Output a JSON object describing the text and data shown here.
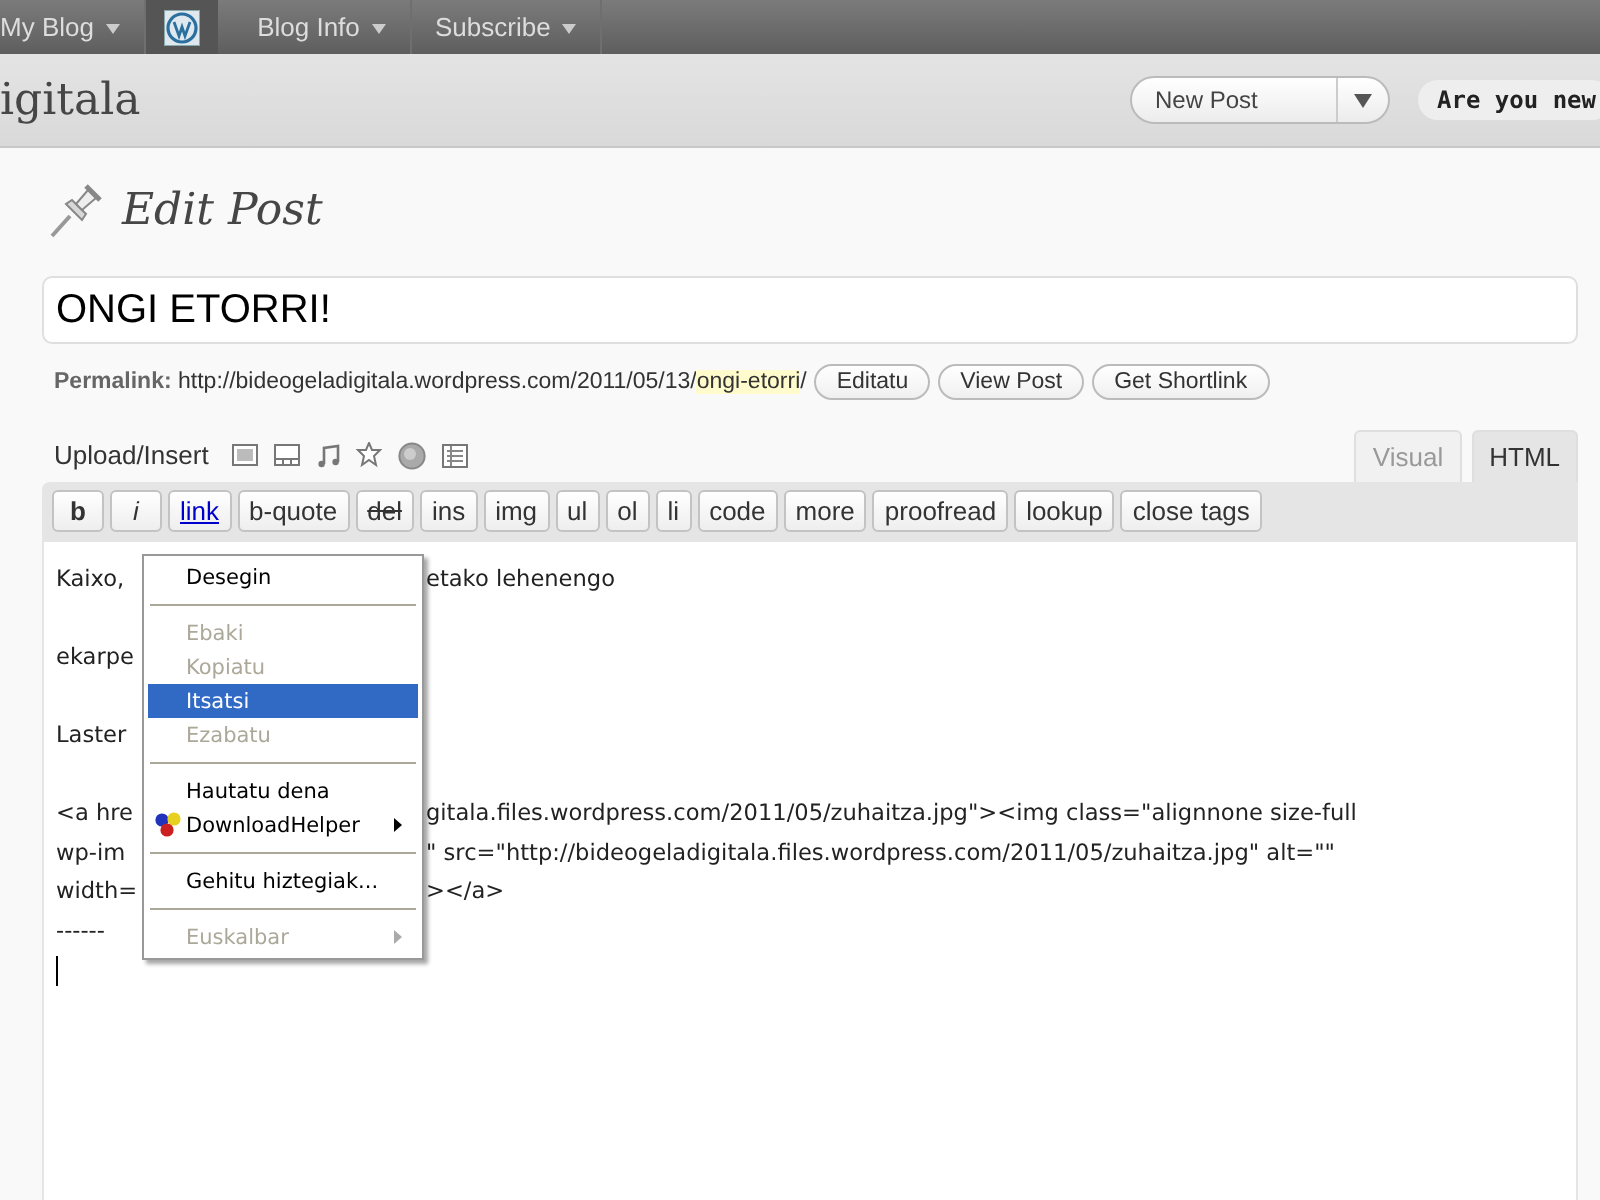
{
  "admin_bar": {
    "items": [
      {
        "label": "My Blog",
        "kind": "menu"
      },
      {
        "kind": "logo"
      },
      {
        "label": "Blog Info",
        "kind": "menu"
      },
      {
        "label": "Subscribe",
        "kind": "menu"
      }
    ]
  },
  "header": {
    "blog_title": "igitala",
    "new_post_button": "New Post",
    "promo": "Are you new"
  },
  "page_title": "Edit Post",
  "post_title": "ONGI ETORRI!",
  "permalink": {
    "label": "Permalink:",
    "url_base": "http://bideogeladigitala.wordpress.com/2011/05/13/",
    "slug": "ongi-etorri",
    "url_end": "/",
    "buttons": [
      "Editatu",
      "View Post",
      "Get Shortlink"
    ]
  },
  "upload_insert": {
    "label": "Upload/Insert",
    "icons": [
      {
        "kind": "image"
      },
      {
        "kind": "video"
      },
      {
        "kind": "audio"
      },
      {
        "kind": "media"
      },
      {
        "kind": "poll"
      },
      {
        "kind": "form"
      }
    ]
  },
  "editor_tabs": [
    {
      "label": "Visual",
      "selected": false
    },
    {
      "label": "HTML",
      "selected": true
    }
  ],
  "quicktags": [
    {
      "label": "b",
      "kind": "bold"
    },
    {
      "label": "i",
      "kind": "italic"
    },
    {
      "label": "link",
      "kind": "link"
    },
    {
      "label": "b-quote",
      "kind": "plain"
    },
    {
      "label": "del",
      "kind": "strike"
    },
    {
      "label": "ins",
      "kind": "plain"
    },
    {
      "label": "img",
      "kind": "plain"
    },
    {
      "label": "ul",
      "kind": "plain"
    },
    {
      "label": "ol",
      "kind": "plain"
    },
    {
      "label": "li",
      "kind": "plain"
    },
    {
      "label": "code",
      "kind": "plain"
    },
    {
      "label": "more",
      "kind": "plain"
    },
    {
      "label": "proofread",
      "kind": "plain"
    },
    {
      "label": "lookup",
      "kind": "plain"
    },
    {
      "label": "close tags",
      "kind": "plain"
    }
  ],
  "editor_lines": [
    {
      "kind": "text",
      "left": "Kaixo,",
      "right": "etako lehenengo"
    },
    {
      "kind": "blank"
    },
    {
      "kind": "text",
      "left": "ekarpe"
    },
    {
      "kind": "blank"
    },
    {
      "kind": "text",
      "left": "Laster"
    },
    {
      "kind": "blank"
    },
    {
      "kind": "text",
      "left": "<a hre",
      "right": "gitala.files.wordpress.com/2011/05/zuhaitza.jpg\"><img class=\"alignnone size-full"
    },
    {
      "kind": "text",
      "left": "wp-im",
      "right": "\" src=\"http://bideogeladigitala.files.wordpress.com/2011/05/zuhaitza.jpg\" alt=\"\""
    },
    {
      "kind": "text",
      "left": "width=",
      "right": "></a>"
    },
    {
      "kind": "text",
      "left": "------"
    }
  ],
  "context_menu": [
    {
      "kind": "item",
      "label": "Desegin",
      "disabled": false,
      "selected": false,
      "submenu": false
    },
    {
      "kind": "separator"
    },
    {
      "kind": "item",
      "label": "Ebaki",
      "disabled": true,
      "selected": false,
      "submenu": false
    },
    {
      "kind": "item",
      "label": "Kopiatu",
      "disabled": true,
      "selected": false,
      "submenu": false
    },
    {
      "kind": "item",
      "label": "Itsatsi",
      "disabled": false,
      "selected": true,
      "submenu": false
    },
    {
      "kind": "item",
      "label": "Ezabatu",
      "disabled": true,
      "selected": false,
      "submenu": false
    },
    {
      "kind": "separator"
    },
    {
      "kind": "item",
      "label": "Hautatu dena",
      "disabled": false,
      "selected": false,
      "submenu": false
    },
    {
      "kind": "addon",
      "label": "DownloadHelper",
      "disabled": false,
      "selected": false,
      "submenu": true
    },
    {
      "kind": "separator"
    },
    {
      "kind": "item",
      "label": "Gehitu hiztegiak...",
      "disabled": false,
      "selected": false,
      "submenu": false
    },
    {
      "kind": "separator"
    },
    {
      "kind": "item",
      "label": "Euskalbar",
      "disabled": true,
      "selected": false,
      "submenu": true
    }
  ]
}
